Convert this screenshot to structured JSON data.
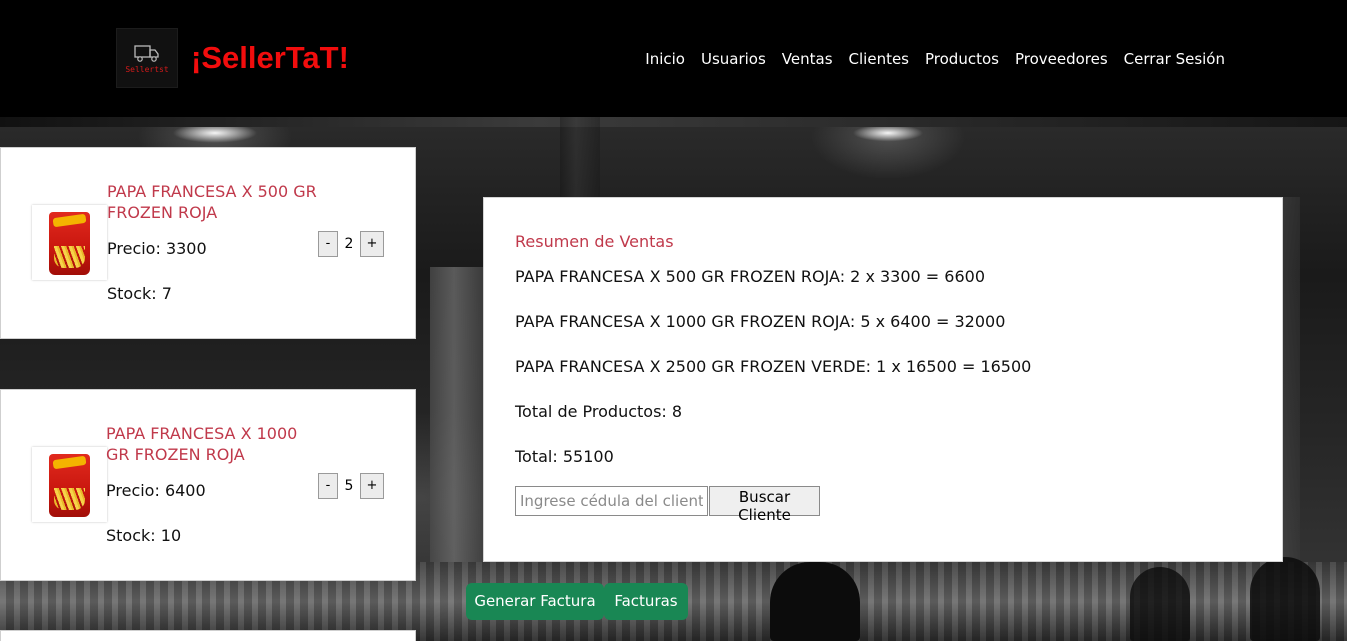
{
  "header": {
    "logo_text": "Sellertst",
    "brand": "¡SellerTaT!",
    "nav": [
      "Inicio",
      "Usuarios",
      "Ventas",
      "Clientes",
      "Productos",
      "Proveedores",
      "Cerrar Sesión"
    ]
  },
  "products": [
    {
      "name": "PAPA FRANCESA X 500 GR FROZEN ROJA",
      "price_label": "Precio: 3300",
      "stock_label": "Stock: 7",
      "quantity": "2",
      "minus": "-",
      "plus": "+"
    },
    {
      "name": "PAPA FRANCESA X 1000 GR FROZEN ROJA",
      "price_label": "Precio: 6400",
      "stock_label": "Stock: 10",
      "quantity": "5",
      "minus": "-",
      "plus": "+"
    }
  ],
  "summary": {
    "title": "Resumen de Ventas",
    "lines": [
      "PAPA FRANCESA X 500 GR FROZEN ROJA: 2 x 3300 = 6600",
      "PAPA FRANCESA X 1000 GR FROZEN ROJA: 5 x 6400 = 32000",
      "PAPA FRANCESA X 2500 GR FROZEN VERDE: 1 x 16500 = 16500"
    ],
    "total_products": "Total de Productos: 8",
    "total": "Total: 55100",
    "cedula_placeholder": "Ingrese cédula del cliente",
    "search_button": "Buscar Cliente"
  },
  "actions": {
    "generate_invoice": "Generar Factura",
    "invoices": "Facturas"
  },
  "colors": {
    "brand": "#f20d0d",
    "product_name": "#c0394b",
    "action_button": "#198754",
    "header_bg": "#000000"
  }
}
